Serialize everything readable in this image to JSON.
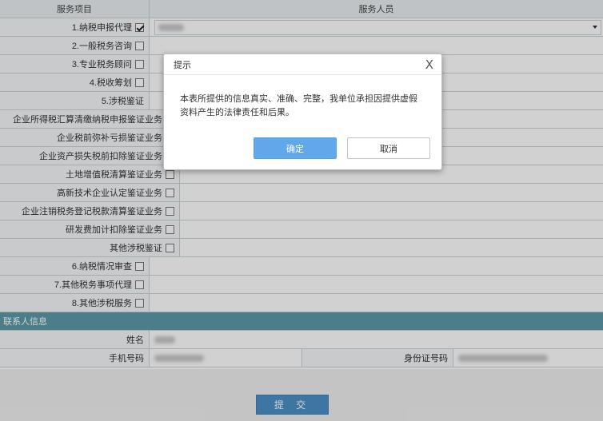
{
  "table": {
    "header_item": "服务项目",
    "header_staff": "服务人员"
  },
  "rows": [
    {
      "label": "1.纳税申报代理",
      "checked": true
    },
    {
      "label": "2.一般税务咨询",
      "checked": false
    },
    {
      "label": "3.专业税务顾问",
      "checked": false
    },
    {
      "label": "4.税收筹划",
      "checked": false
    },
    {
      "label": "5.涉税鉴证"
    }
  ],
  "sub_rows": [
    {
      "label": "企业所得税汇算清缴纳税申报鉴证业务"
    },
    {
      "label": "企业税前弥补亏损鉴证业务"
    },
    {
      "label": "企业资产损失税前扣除鉴证业务"
    },
    {
      "label": "土地增值税清算鉴证业务"
    },
    {
      "label": "高新技术企业认定鉴证业务"
    },
    {
      "label": "企业注销税务登记税款清算鉴证业务"
    },
    {
      "label": "研发费加计扣除鉴证业务"
    },
    {
      "label": "其他涉税鉴证"
    }
  ],
  "rows2": [
    {
      "label": "6.纳税情况审查"
    },
    {
      "label": "7.其他税务事项代理"
    },
    {
      "label": "8.其他涉税服务"
    }
  ],
  "contact": {
    "section_title": "联系人信息",
    "name_label": "姓名",
    "phone_label": "手机号码",
    "id_label": "身份证号码"
  },
  "submit_label": "提 交",
  "dialog": {
    "title": "提示",
    "close_glyph": "X",
    "message": "本表所提供的信息真实、准确、完整，我单位承担因提供虚假资料产生的法律责任和后果。",
    "ok_label": "确定",
    "cancel_label": "取消"
  },
  "colors": {
    "section_bg": "#5b9ca8",
    "ok_button": "#61a8eb",
    "submit_button": "#4b90c7"
  }
}
